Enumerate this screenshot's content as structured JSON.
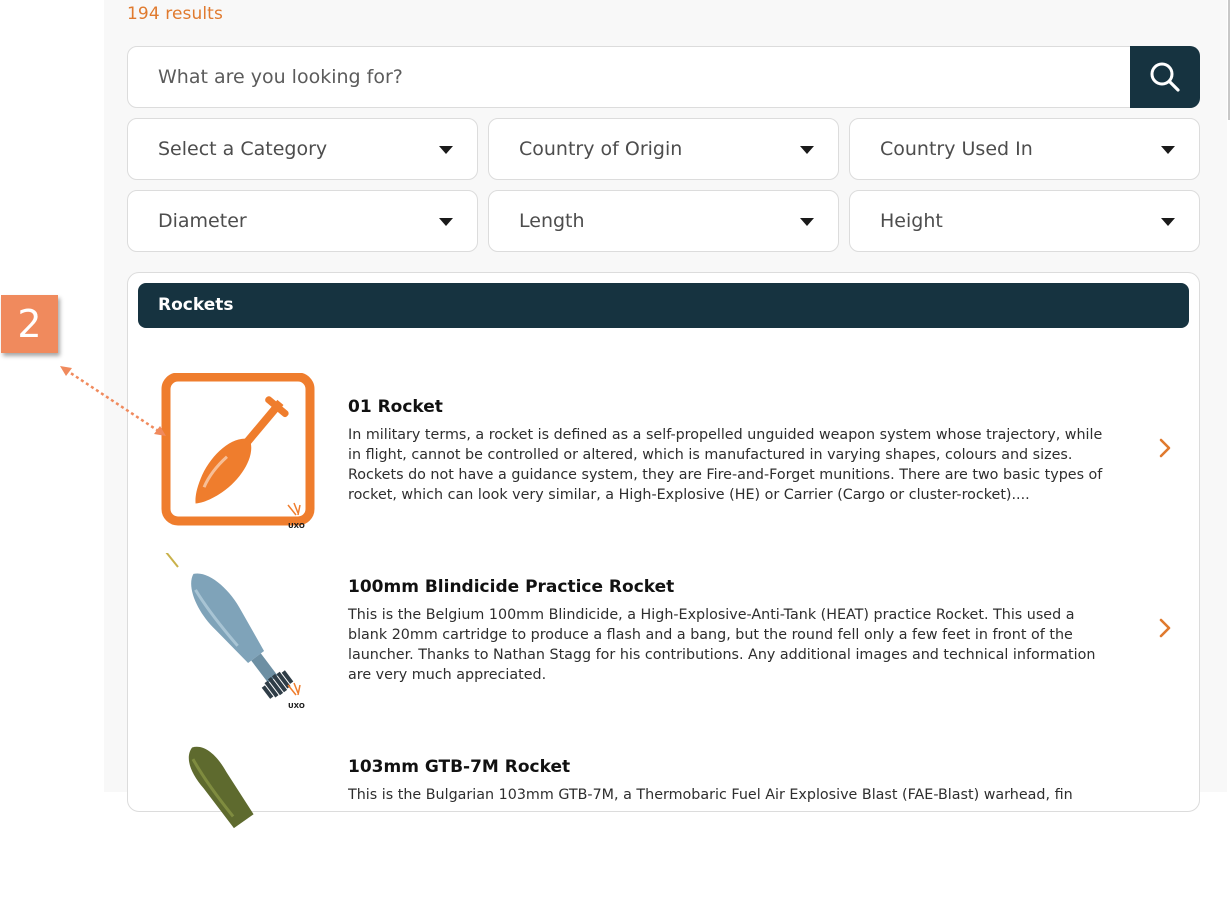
{
  "results": {
    "count_label": "194 results"
  },
  "search": {
    "placeholder": "What are you looking for?",
    "value": ""
  },
  "filters": [
    {
      "label": "Select a Category"
    },
    {
      "label": "Country of Origin"
    },
    {
      "label": "Country Used In"
    },
    {
      "label": "Diameter"
    },
    {
      "label": "Length"
    },
    {
      "label": "Height"
    }
  ],
  "section": {
    "title": "Rockets"
  },
  "items": [
    {
      "title": "01 Rocket",
      "description": "In military terms, a rocket is defined as a self-propelled unguided weapon system whose trajectory, while in flight, cannot be controlled or altered, which is manufactured in varying shapes, colours and sizes. Rockets do not have a guidance system, they are Fire-and-Forget munitions. There are two basic types of rocket, which can look very similar, a High-Explosive (HE) or Carrier (Cargo or cluster-rocket)....",
      "watermark": "UXO"
    },
    {
      "title": "100mm Blindicide Practice Rocket",
      "description": "This is the Belgium 100mm Blindicide, a High-Explosive-Anti-Tank (HEAT) practice Rocket. This used a blank 20mm cartridge to produce a flash and a bang, but the round fell only a few feet in front of the launcher. Thanks to Nathan Stagg for his contributions. Any additional images and technical information are very much appreciated.",
      "watermark": "UXO"
    },
    {
      "title": "103mm GTB-7M Rocket",
      "description": "This is the Bulgarian 103mm GTB-7M, a Thermobaric Fuel Air Explosive Blast (FAE-Blast) warhead, fin"
    }
  ],
  "annotation": {
    "badge": "2"
  },
  "colors": {
    "accent": "#e07a2e",
    "header_dark": "#163340",
    "callout": "#f08a5d"
  },
  "icons": {
    "search": "search-icon",
    "caret": "caret-down-icon",
    "chevron": "chevron-right-icon"
  }
}
